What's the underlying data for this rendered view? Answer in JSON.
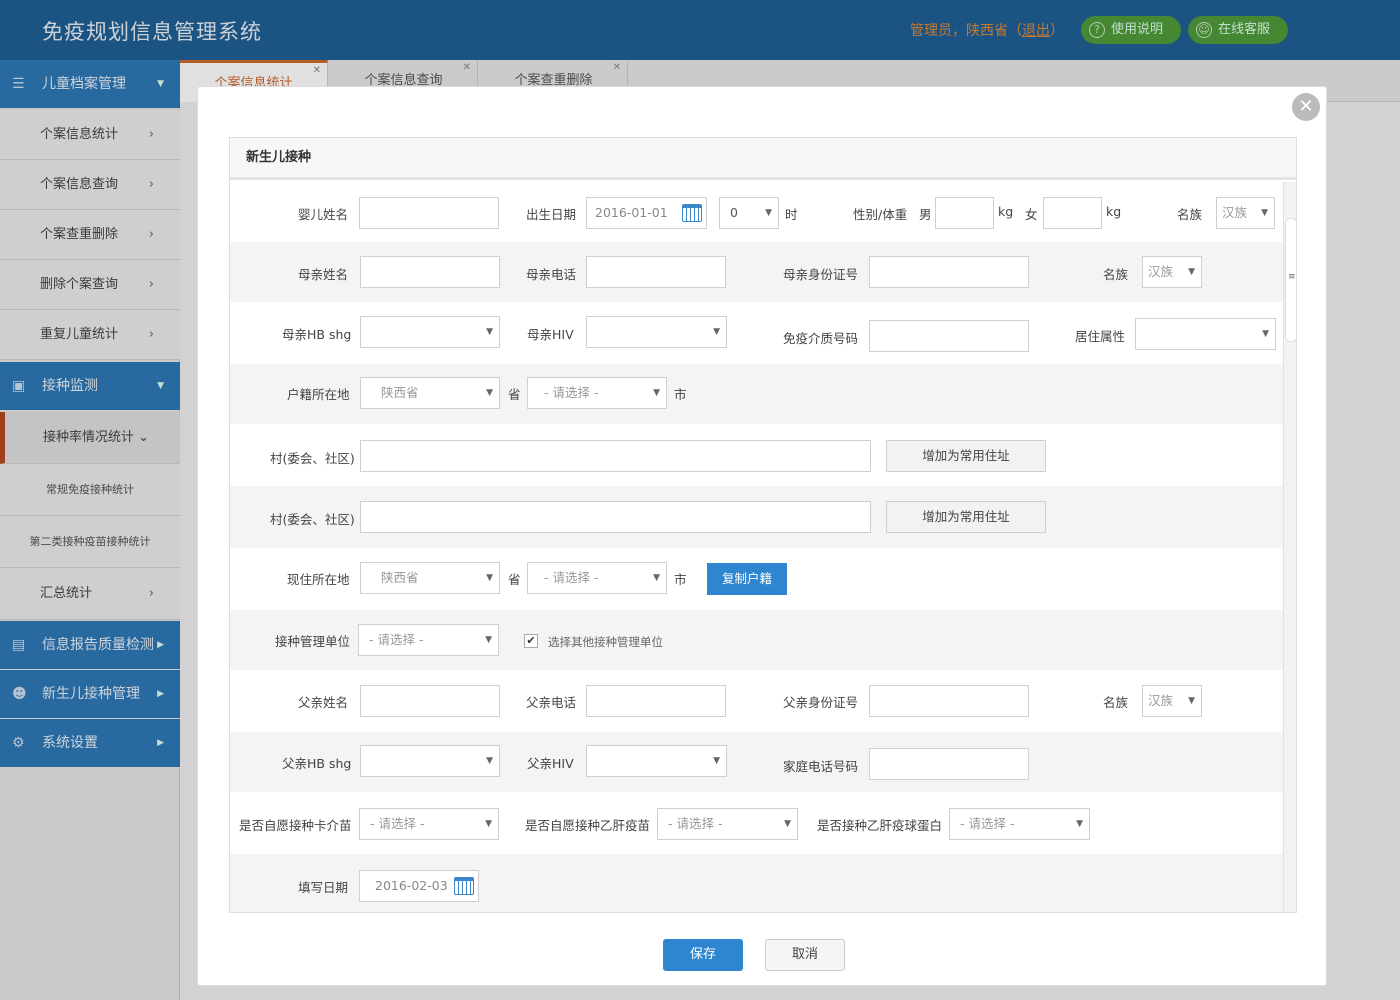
{
  "header": {
    "title": "免疫规划信息管理系统",
    "user_prefix": "管理员，陕西省（",
    "logout": "退出",
    "user_suffix": "）",
    "help_btn": "使用说明",
    "service_btn": "在线客服"
  },
  "sidebar": {
    "group1": "儿童档案管理",
    "items": [
      "个案信息统计",
      "个案信息查询",
      "个案查重删除",
      "删除个案查询",
      "重复儿童统计"
    ],
    "group2": "接种监测",
    "sub_active": "接种率情况统计",
    "sub_items": [
      "常规免疫接种统计",
      "第二类接种疫苗接种统计"
    ],
    "summary": "汇总统计",
    "group3": "信息报告质量检测",
    "group4": "新生儿接种管理",
    "group5": "系统设置"
  },
  "tabs": [
    "个案信息统计",
    "个案信息查询",
    "个案查重删除"
  ],
  "modal": {
    "panel_title": "新生儿接种",
    "close": "✕",
    "labels": {
      "baby_name": "婴儿姓名",
      "birth_date": "出生日期",
      "hour": "时",
      "gender_weight": "性别/体重",
      "male": "男",
      "kg1": "kg",
      "female": "女",
      "kg2": "kg",
      "ethnicity1": "名族",
      "mother_name": "母亲姓名",
      "mother_phone": "母亲电话",
      "mother_id": "母亲身份证号",
      "ethnicity2": "名族",
      "mother_hb": "母亲HB shg",
      "mother_hiv": "母亲HIV",
      "vacc_card": "免疫介质号码",
      "residence": "居住属性",
      "household": "户籍所在地",
      "province1": "省",
      "city1": "市",
      "village1": "村(委会、社区)",
      "village2": "村(委会、社区)",
      "current": "现住所在地",
      "province2": "省",
      "city2": "市",
      "vacc_unit": "接种管理单位",
      "other_unit": "选择其他接种管理单位",
      "father_name": "父亲姓名",
      "father_phone": "父亲电话",
      "father_id": "父亲身份证号",
      "ethnicity3": "名族",
      "father_hb": "父亲HB shg",
      "father_hiv": "父亲HIV",
      "home_phone": "家庭电话号码",
      "bcg_voluntary": "是否自愿接种卡介苗",
      "hepb_voluntary": "是否自愿接种乙肝疫苗",
      "hepb_globulin": "是否接种乙肝疫球蛋白",
      "fill_date": "填写日期"
    },
    "values": {
      "birth_date": "2016-01-01",
      "hour": "0",
      "ethnicity1": "汉族",
      "ethnicity2": "汉族",
      "ethnicity3": "汉族",
      "household_province": "陕西省",
      "household_city": "- 请选择 -",
      "current_province": "陕西省",
      "current_city": "- 请选择 -",
      "vacc_unit": "- 请选择 -",
      "bcg": "- 请选择 -",
      "hepb": "- 请选择 -",
      "globulin": "- 请选择 -",
      "fill_date": "2016-02-03",
      "checkbox": "✔"
    },
    "buttons": {
      "add_address1": "增加为常用住址",
      "add_address2": "增加为常用住址",
      "copy_household": "复制户籍",
      "save": "保存",
      "cancel": "取消"
    }
  },
  "icons": {
    "dropdown": "▼",
    "chevron_right": "›",
    "caret_down": "▼",
    "caret_right": "▶",
    "scroll_grip": "≡"
  },
  "colors": {
    "header_bg": "#1f5f94",
    "sidebar_group": "#2e78b6",
    "primary_button": "#2f86d0",
    "accent": "#d06a30",
    "green_button": "#4f9a3a"
  }
}
